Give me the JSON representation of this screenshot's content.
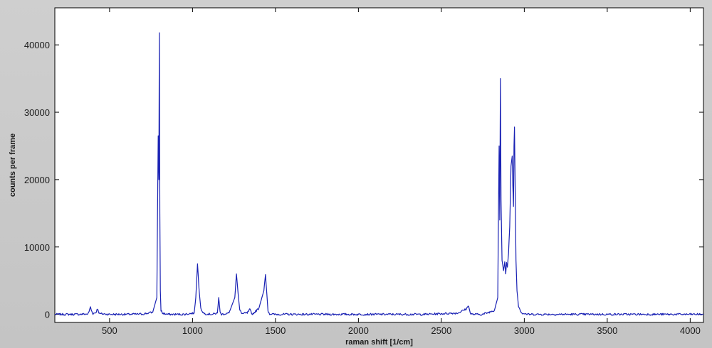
{
  "chart_data": {
    "type": "line",
    "title": "",
    "xlabel": "raman shift [1/cm]",
    "ylabel": "counts per frame",
    "xlim": [
      170,
      4080
    ],
    "ylim": [
      -1200,
      45500
    ],
    "xticks": [
      500,
      1000,
      1500,
      2000,
      2500,
      3000,
      3500,
      4000
    ],
    "yticks": [
      0,
      10000,
      20000,
      30000,
      40000
    ],
    "grid": false,
    "line_color": "#1a22b4",
    "plot_background": "#ffffff",
    "series": [
      {
        "x": [
          170,
          300,
          370,
          380,
          385,
          390,
          400,
          420,
          425,
          430,
          440,
          500,
          600,
          700,
          760,
          785,
          793,
          797,
          800,
          803,
          806,
          810,
          820,
          850,
          950,
          1010,
          1020,
          1030,
          1040,
          1050,
          1070,
          1120,
          1150,
          1158,
          1162,
          1166,
          1175,
          1220,
          1255,
          1265,
          1275,
          1285,
          1300,
          1330,
          1345,
          1350,
          1356,
          1365,
          1400,
          1430,
          1440,
          1448,
          1455,
          1465,
          1490,
          1600,
          1800,
          2000,
          2200,
          2400,
          2600,
          2650,
          2665,
          2670,
          2675,
          2690,
          2750,
          2820,
          2840,
          2848,
          2852,
          2856,
          2860,
          2866,
          2875,
          2882,
          2888,
          2893,
          2898,
          2905,
          2912,
          2920,
          2927,
          2931,
          2935,
          2938,
          2941,
          2945,
          2950,
          2956,
          2965,
          2985,
          3020,
          3100,
          3300,
          3500,
          3700,
          3900,
          4080
        ],
        "y": [
          0,
          0,
          50,
          700,
          1100,
          600,
          100,
          300,
          900,
          600,
          100,
          0,
          0,
          50,
          300,
          2500,
          26500,
          20000,
          41800,
          15000,
          3500,
          600,
          150,
          0,
          0,
          200,
          2500,
          7500,
          3500,
          800,
          100,
          0,
          200,
          2500,
          1500,
          300,
          0,
          200,
          2500,
          6000,
          3000,
          600,
          100,
          200,
          700,
          500,
          100,
          100,
          900,
          3500,
          5900,
          3000,
          500,
          80,
          0,
          0,
          0,
          0,
          0,
          0,
          200,
          800,
          1300,
          700,
          100,
          0,
          0,
          600,
          2500,
          25000,
          14000,
          35000,
          17000,
          8000,
          6500,
          7800,
          6000,
          7700,
          7000,
          9000,
          13000,
          22000,
          23500,
          19000,
          16000,
          25000,
          27800,
          18000,
          8000,
          3500,
          1200,
          200,
          0,
          0,
          0,
          0,
          0,
          0,
          0
        ]
      }
    ]
  }
}
